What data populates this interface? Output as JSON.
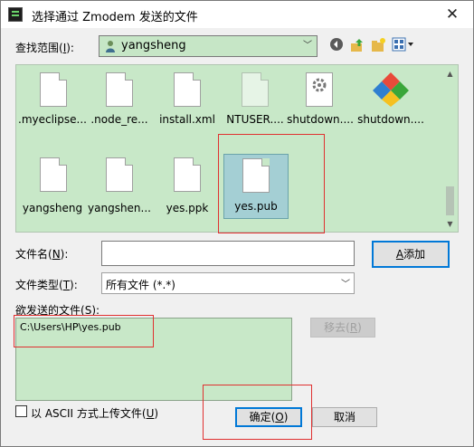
{
  "window": {
    "title": "选择通过 Zmodem 发送的文件",
    "close_glyph": "✕"
  },
  "look_in": {
    "label": "查找范围(",
    "accel": "I",
    "label_end": "):",
    "value": "yangsheng"
  },
  "toolbar": {
    "back_icon": "back-icon",
    "up_icon": "up-folder-icon",
    "new_folder_icon": "new-folder-icon",
    "view_icon": "view-menu-icon"
  },
  "files": {
    "row1": [
      ".myeclipse...",
      ".node_re...",
      "install.xml",
      "NTUSER....",
      "shutdown....",
      "shutdown...."
    ],
    "row2": [
      "yangsheng",
      "yangshen...",
      "yes.ppk",
      "yes.pub"
    ],
    "selected": "yes.pub"
  },
  "filename": {
    "label": "文件名(",
    "accel": "N",
    "label_end": "):",
    "value": ""
  },
  "add_button": {
    "accel": "A",
    "label": "添加"
  },
  "filetype": {
    "label": "文件类型(",
    "accel": "T",
    "label_end": "):",
    "value": "所有文件 (*.*)"
  },
  "send_list": {
    "label": "欲发送的文件(",
    "accel": "S",
    "label_end": "):",
    "items": [
      "C:\\Users\\HP\\yes.pub"
    ]
  },
  "remove_button": {
    "label": "移去(",
    "accel": "R",
    "label_end": ")"
  },
  "ascii_option": {
    "label": "以 ASCII 方式上传文件(",
    "accel": "U",
    "label_end": ")",
    "checked": false
  },
  "ok_button": {
    "label": "确定(",
    "accel": "O",
    "label_end": ")"
  },
  "cancel_button": {
    "label": "取消"
  },
  "colors": {
    "list_background": "#c8e8c8",
    "selected_item": "#a4cfd4",
    "annotation_red": "#e03030",
    "primary_border": "#0078d7"
  }
}
